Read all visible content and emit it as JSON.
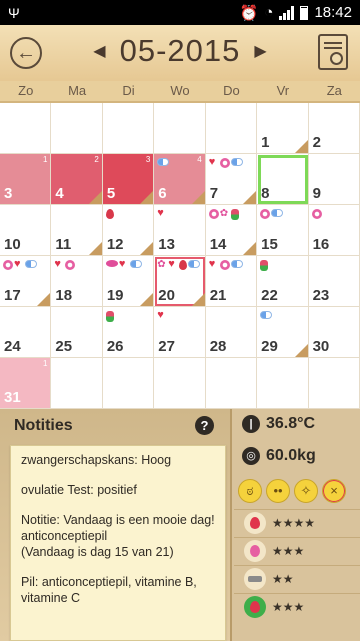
{
  "status_bar": {
    "usb_icon": "usb-icon",
    "time": "18:42"
  },
  "header": {
    "month_label": "05-2015",
    "prev_arrow": "◀",
    "next_arrow": "▶"
  },
  "weekdays": [
    "Zo",
    "Ma",
    "Di",
    "Wo",
    "Do",
    "Vr",
    "Za"
  ],
  "calendar": {
    "weeks": [
      [
        {
          "d": "",
          "s": ""
        },
        {
          "d": "",
          "s": ""
        },
        {
          "d": "",
          "s": ""
        },
        {
          "d": "",
          "s": ""
        },
        {
          "d": "",
          "s": ""
        },
        {
          "d": "1",
          "s": ""
        },
        {
          "d": "2",
          "s": ""
        }
      ],
      [
        {
          "d": "3",
          "s": "1"
        },
        {
          "d": "4",
          "s": "2"
        },
        {
          "d": "5",
          "s": "3"
        },
        {
          "d": "6",
          "s": "4"
        },
        {
          "d": "7",
          "s": ""
        },
        {
          "d": "8",
          "s": ""
        },
        {
          "d": "9",
          "s": ""
        }
      ],
      [
        {
          "d": "10",
          "s": ""
        },
        {
          "d": "11",
          "s": ""
        },
        {
          "d": "12",
          "s": ""
        },
        {
          "d": "13",
          "s": ""
        },
        {
          "d": "14",
          "s": ""
        },
        {
          "d": "15",
          "s": ""
        },
        {
          "d": "16",
          "s": ""
        }
      ],
      [
        {
          "d": "17",
          "s": ""
        },
        {
          "d": "18",
          "s": ""
        },
        {
          "d": "19",
          "s": ""
        },
        {
          "d": "20",
          "s": ""
        },
        {
          "d": "21",
          "s": ""
        },
        {
          "d": "22",
          "s": ""
        },
        {
          "d": "23",
          "s": ""
        }
      ],
      [
        {
          "d": "24",
          "s": ""
        },
        {
          "d": "25",
          "s": ""
        },
        {
          "d": "26",
          "s": ""
        },
        {
          "d": "27",
          "s": ""
        },
        {
          "d": "28",
          "s": ""
        },
        {
          "d": "29",
          "s": ""
        },
        {
          "d": "30",
          "s": ""
        }
      ],
      [
        {
          "d": "31",
          "s": "1"
        },
        {
          "d": "",
          "s": ""
        },
        {
          "d": "",
          "s": ""
        },
        {
          "d": "",
          "s": ""
        },
        {
          "d": "",
          "s": ""
        },
        {
          "d": "",
          "s": ""
        },
        {
          "d": "",
          "s": ""
        }
      ]
    ]
  },
  "notes": {
    "title": "Notities",
    "help": "?",
    "line1": "zwangerschapskans: Hoog",
    "line2": "ovulatie Test:  positief",
    "line3": "Notitie:  Vandaag is een mooie dag!",
    "line4": "anticonceptiepil",
    "line5": "(Vandaag is dag 15 van 21)",
    "line6": "Pil:  anticonceptiepil, vitamine B,  vitamine C"
  },
  "stats": {
    "temperature": "36.8°C",
    "weight": "60.0kg",
    "ratings": [
      {
        "icon": "drop-icon",
        "stars": "★★★★",
        "color": "#e0344c"
      },
      {
        "icon": "flower-icon",
        "stars": "★★★",
        "color": "#e65fa2"
      },
      {
        "icon": "dumbbell-icon",
        "stars": "★★",
        "color": "#8a8a8a"
      },
      {
        "icon": "strawberry-icon",
        "stars": "★★★",
        "color": "#e0344c"
      }
    ]
  },
  "colors": {
    "period_dark": "#de4a5a",
    "period_light": "#f4b8c2",
    "fertile": "#7ed957",
    "header_bg": "#e6c893"
  }
}
